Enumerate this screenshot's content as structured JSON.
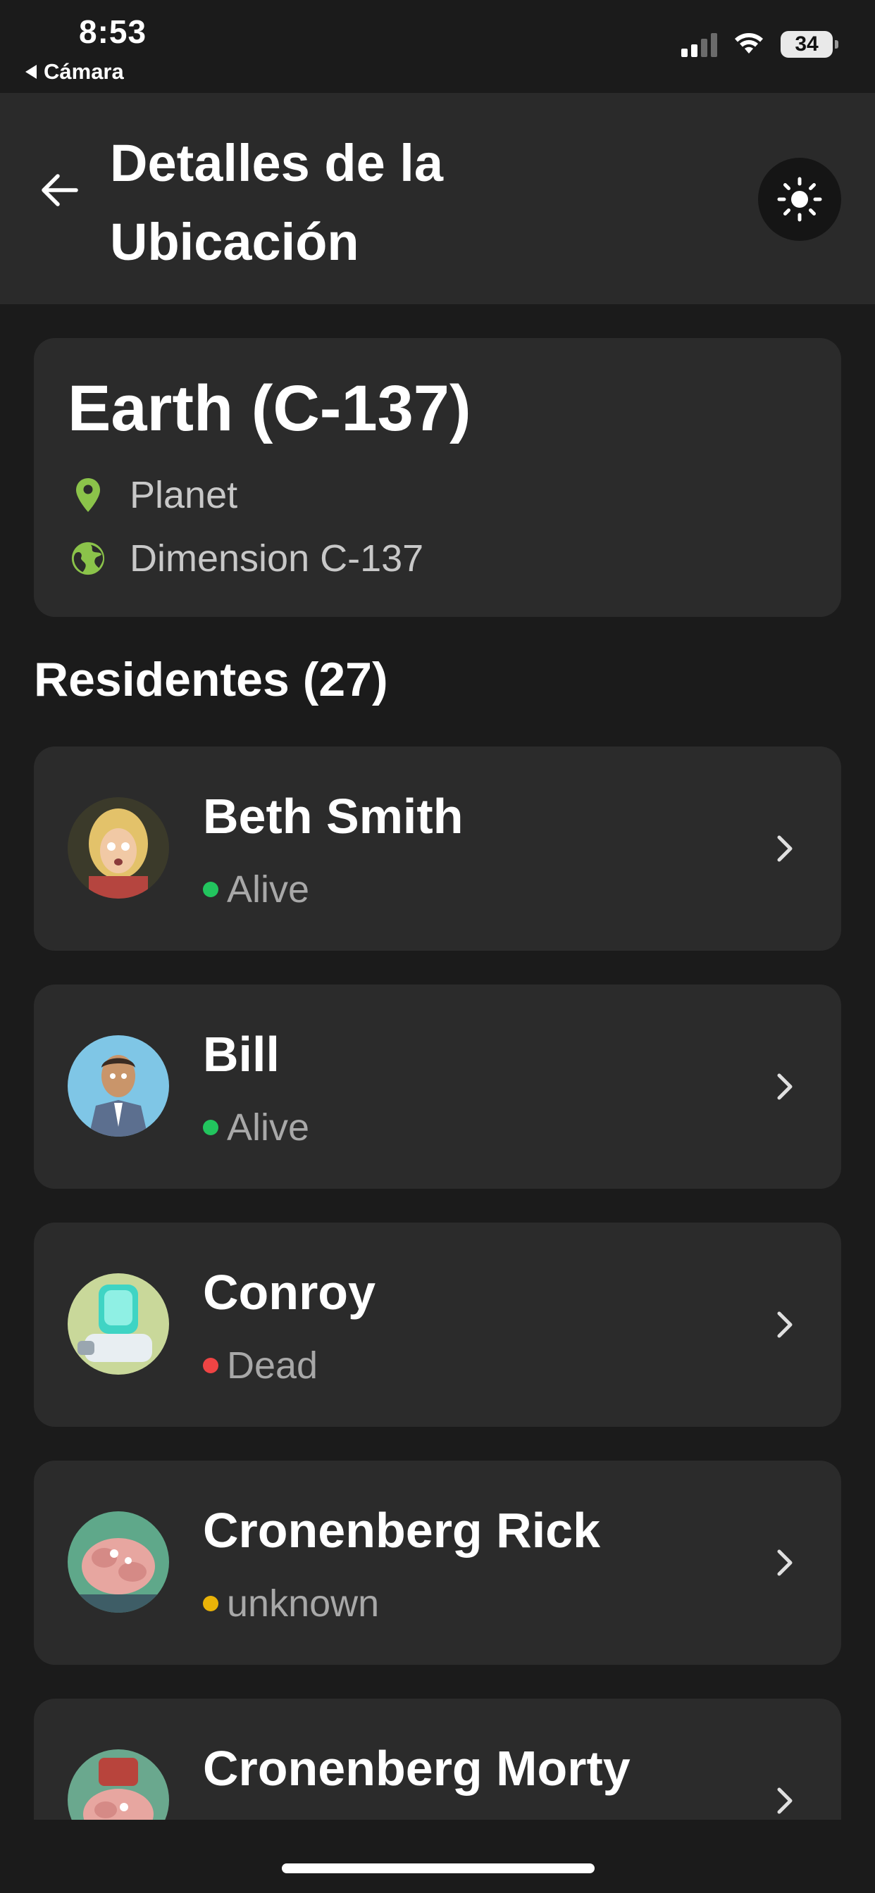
{
  "status_bar": {
    "time": "8:53",
    "back_app": "Cámara",
    "battery": "34"
  },
  "header": {
    "title": "Detalles de la Ubicación",
    "back_icon": "arrow-left-icon",
    "theme_icon": "sun-icon"
  },
  "location": {
    "name": "Earth (C-137)",
    "type": "Planet",
    "dimension": "Dimension C-137",
    "accent_color": "#8bc34a"
  },
  "residents_title": "Residentes (27)",
  "residents": [
    {
      "name": "Beth Smith",
      "status": "Alive",
      "status_color": "#22c55e"
    },
    {
      "name": "Bill",
      "status": "Alive",
      "status_color": "#22c55e"
    },
    {
      "name": "Conroy",
      "status": "Dead",
      "status_color": "#ef4444"
    },
    {
      "name": "Cronenberg Rick",
      "status": "unknown",
      "status_color": "#eab308"
    },
    {
      "name": "Cronenberg Morty",
      "status": "",
      "status_color": "#eab308"
    }
  ]
}
